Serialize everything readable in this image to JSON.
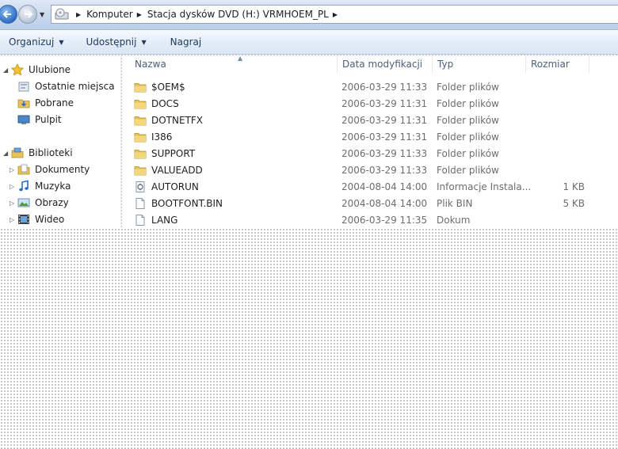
{
  "address": {
    "crumbs": [
      "Komputer",
      "Stacja dysków DVD (H:) VRMHOEM_PL"
    ]
  },
  "toolbar": {
    "organize": "Organizuj",
    "share": "Udostępnij",
    "burn": "Nagraj"
  },
  "sidebar": {
    "favorites": {
      "label": "Ulubione",
      "items": [
        "Ostatnie miejsca",
        "Pobrane",
        "Pulpit"
      ]
    },
    "libraries": {
      "label": "Biblioteki",
      "items": [
        "Dokumenty",
        "Muzyka",
        "Obrazy",
        "Wideo"
      ]
    }
  },
  "columns": {
    "name": "Nazwa",
    "date": "Data modyfikacji",
    "type": "Typ",
    "size": "Rozmiar"
  },
  "files": [
    {
      "name": "$OEM$",
      "date": "2006-03-29 11:33",
      "type": "Folder plików",
      "size": "",
      "icon": "folder-icon"
    },
    {
      "name": "DOCS",
      "date": "2006-03-29 11:31",
      "type": "Folder plików",
      "size": "",
      "icon": "folder-icon"
    },
    {
      "name": "DOTNETFX",
      "date": "2006-03-29 11:31",
      "type": "Folder plików",
      "size": "",
      "icon": "folder-icon"
    },
    {
      "name": "I386",
      "date": "2006-03-29 11:31",
      "type": "Folder plików",
      "size": "",
      "icon": "folder-icon"
    },
    {
      "name": "SUPPORT",
      "date": "2006-03-29 11:33",
      "type": "Folder plików",
      "size": "",
      "icon": "folder-icon"
    },
    {
      "name": "VALUEADD",
      "date": "2006-03-29 11:33",
      "type": "Folder plików",
      "size": "",
      "icon": "folder-icon"
    },
    {
      "name": "AUTORUN",
      "date": "2004-08-04 14:00",
      "type": "Informacje Instala...",
      "size": "1 KB",
      "icon": "setup-info-icon"
    },
    {
      "name": "BOOTFONT.BIN",
      "date": "2004-08-04 14:00",
      "type": "Plik BIN",
      "size": "5 KB",
      "icon": "file-icon"
    },
    {
      "name": "LANG",
      "date": "2006-03-29 11:35",
      "type": "Dokum",
      "size": "",
      "icon": "file-icon"
    }
  ],
  "colors": {
    "accent": "#2c6cc4",
    "folder": "#e8c35a",
    "header_text": "#4c607a"
  }
}
